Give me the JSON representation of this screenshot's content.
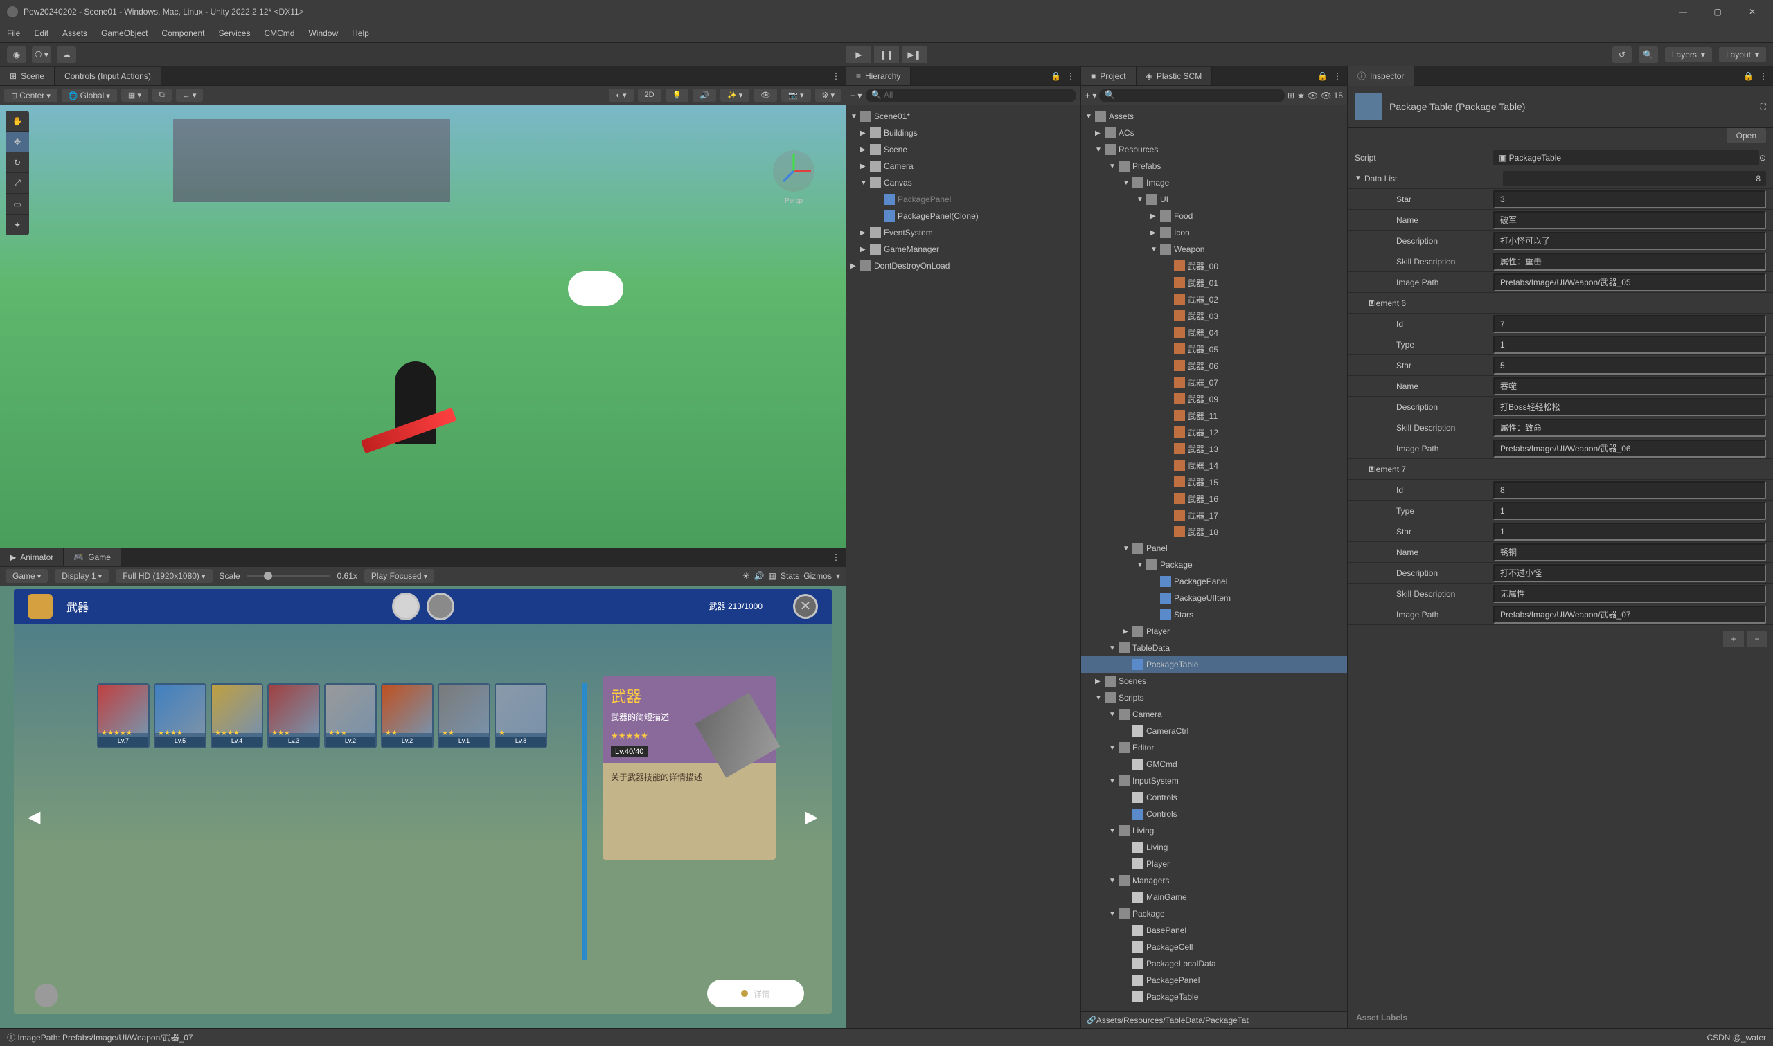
{
  "window": {
    "title": "Pow20240202 - Scene01 - Windows, Mac, Linux - Unity 2022.2.12* <DX11>",
    "min": "—",
    "max": "▢",
    "close": "✕"
  },
  "menu": [
    "File",
    "Edit",
    "Assets",
    "GameObject",
    "Component",
    "Services",
    "CMCmd",
    "Window",
    "Help"
  ],
  "toolbar": {
    "layers": "Layers",
    "layout": "Layout"
  },
  "scene": {
    "tab": "Scene",
    "controls_tab": "Controls (Input Actions)",
    "pivot": "Center",
    "space": "Global",
    "two_d": "2D",
    "persp": "Persp"
  },
  "animator_tab": "Animator",
  "game": {
    "tab": "Game",
    "target": "Game",
    "display": "Display 1",
    "res": "Full HD (1920x1080)",
    "scale_label": "Scale",
    "scale_val": "0.61x",
    "play_focused": "Play Focused",
    "stats": "Stats",
    "gizmos": "Gizmos",
    "bag_label": "武器",
    "count": "武器 213/1000",
    "weapons": [
      {
        "lv": "Lv.7",
        "stars": "★★★★★",
        "tint": "#c04040"
      },
      {
        "lv": "Lv.5",
        "stars": "★★★★",
        "tint": "#4080c0"
      },
      {
        "lv": "Lv.4",
        "stars": "★★★★",
        "tint": "#c0a040"
      },
      {
        "lv": "Lv.3",
        "stars": "★★★",
        "tint": "#a04040"
      },
      {
        "lv": "Lv.2",
        "stars": "★★★",
        "tint": "#9a9a9a"
      },
      {
        "lv": "Lv.2",
        "stars": "★★",
        "tint": "#c05020"
      },
      {
        "lv": "Lv.1",
        "stars": "★★",
        "tint": "#7a7a7a"
      },
      {
        "lv": "Lv.8",
        "stars": "★",
        "tint": "#8a9aaa"
      }
    ],
    "detail": {
      "title": "武器",
      "sub": "武器的简短描述",
      "stars": "★★★★★",
      "level": "Lv.40/40",
      "desc": "关于武器技能的详情描述",
      "btn": "详情"
    }
  },
  "hierarchy": {
    "tab": "Hierarchy",
    "search_placeholder": "All",
    "items": [
      {
        "label": "Scene01*",
        "depth": 0,
        "icon": "scene",
        "open": true
      },
      {
        "label": "Buildings",
        "depth": 1,
        "icon": "go"
      },
      {
        "label": "Scene",
        "depth": 1,
        "icon": "go"
      },
      {
        "label": "Camera",
        "depth": 1,
        "icon": "go"
      },
      {
        "label": "Canvas",
        "depth": 1,
        "icon": "go",
        "open": true
      },
      {
        "label": "PackagePanel",
        "depth": 2,
        "icon": "prefab",
        "dim": true
      },
      {
        "label": "PackagePanel(Clone)",
        "depth": 2,
        "icon": "prefab"
      },
      {
        "label": "EventSystem",
        "depth": 1,
        "icon": "go"
      },
      {
        "label": "GameManager",
        "depth": 1,
        "icon": "go"
      },
      {
        "label": "DontDestroyOnLoad",
        "depth": 0,
        "icon": "scene"
      }
    ]
  },
  "project": {
    "tab": "Project",
    "scm_tab": "Plastic SCM",
    "fav_count": "15",
    "tree": [
      {
        "label": "Assets",
        "depth": 0,
        "icon": "folder",
        "open": true
      },
      {
        "label": "ACs",
        "depth": 1,
        "icon": "folder"
      },
      {
        "label": "Resources",
        "depth": 1,
        "icon": "folder",
        "open": true
      },
      {
        "label": "Prefabs",
        "depth": 2,
        "icon": "folder",
        "open": true
      },
      {
        "label": "Image",
        "depth": 3,
        "icon": "folder",
        "open": true
      },
      {
        "label": "UI",
        "depth": 4,
        "icon": "folder",
        "open": true
      },
      {
        "label": "Food",
        "depth": 5,
        "icon": "folder"
      },
      {
        "label": "Icon",
        "depth": 5,
        "icon": "folder"
      },
      {
        "label": "Weapon",
        "depth": 5,
        "icon": "folder",
        "open": true
      },
      {
        "label": "武器_00",
        "depth": 6,
        "icon": "wp"
      },
      {
        "label": "武器_01",
        "depth": 6,
        "icon": "wp"
      },
      {
        "label": "武器_02",
        "depth": 6,
        "icon": "wp"
      },
      {
        "label": "武器_03",
        "depth": 6,
        "icon": "wp"
      },
      {
        "label": "武器_04",
        "depth": 6,
        "icon": "wp"
      },
      {
        "label": "武器_05",
        "depth": 6,
        "icon": "wp"
      },
      {
        "label": "武器_06",
        "depth": 6,
        "icon": "wp"
      },
      {
        "label": "武器_07",
        "depth": 6,
        "icon": "wp"
      },
      {
        "label": "武器_09",
        "depth": 6,
        "icon": "wp"
      },
      {
        "label": "武器_11",
        "depth": 6,
        "icon": "wp"
      },
      {
        "label": "武器_12",
        "depth": 6,
        "icon": "wp"
      },
      {
        "label": "武器_13",
        "depth": 6,
        "icon": "wp"
      },
      {
        "label": "武器_14",
        "depth": 6,
        "icon": "wp"
      },
      {
        "label": "武器_15",
        "depth": 6,
        "icon": "wp"
      },
      {
        "label": "武器_16",
        "depth": 6,
        "icon": "wp"
      },
      {
        "label": "武器_17",
        "depth": 6,
        "icon": "wp"
      },
      {
        "label": "武器_18",
        "depth": 6,
        "icon": "wp"
      },
      {
        "label": "Panel",
        "depth": 3,
        "icon": "folder",
        "open": true
      },
      {
        "label": "Package",
        "depth": 4,
        "icon": "folder",
        "open": true
      },
      {
        "label": "PackagePanel",
        "depth": 5,
        "icon": "prefab"
      },
      {
        "label": "PackageUIItem",
        "depth": 5,
        "icon": "prefab"
      },
      {
        "label": "Stars",
        "depth": 5,
        "icon": "prefab"
      },
      {
        "label": "Player",
        "depth": 3,
        "icon": "folder"
      },
      {
        "label": "TableData",
        "depth": 2,
        "icon": "folder",
        "open": true
      },
      {
        "label": "PackageTable",
        "depth": 3,
        "icon": "asset",
        "selected": true
      },
      {
        "label": "Scenes",
        "depth": 1,
        "icon": "folder"
      },
      {
        "label": "Scripts",
        "depth": 1,
        "icon": "folder",
        "open": true
      },
      {
        "label": "Camera",
        "depth": 2,
        "icon": "folder",
        "open": true
      },
      {
        "label": "CameraCtrl",
        "depth": 3,
        "icon": "cs"
      },
      {
        "label": "Editor",
        "depth": 2,
        "icon": "folder",
        "open": true
      },
      {
        "label": "GMCmd",
        "depth": 3,
        "icon": "cs"
      },
      {
        "label": "InputSystem",
        "depth": 2,
        "icon": "folder",
        "open": true
      },
      {
        "label": "Controls",
        "depth": 3,
        "icon": "cs"
      },
      {
        "label": "Controls",
        "depth": 3,
        "icon": "asset"
      },
      {
        "label": "Living",
        "depth": 2,
        "icon": "folder",
        "open": true
      },
      {
        "label": "Living",
        "depth": 3,
        "icon": "cs"
      },
      {
        "label": "Player",
        "depth": 3,
        "icon": "cs"
      },
      {
        "label": "Managers",
        "depth": 2,
        "icon": "folder",
        "open": true
      },
      {
        "label": "MainGame",
        "depth": 3,
        "icon": "cs"
      },
      {
        "label": "Package",
        "depth": 2,
        "icon": "folder",
        "open": true
      },
      {
        "label": "BasePanel",
        "depth": 3,
        "icon": "cs"
      },
      {
        "label": "PackageCell",
        "depth": 3,
        "icon": "cs"
      },
      {
        "label": "PackageLocalData",
        "depth": 3,
        "icon": "cs"
      },
      {
        "label": "PackagePanel",
        "depth": 3,
        "icon": "cs"
      },
      {
        "label": "PackageTable",
        "depth": 3,
        "icon": "cs"
      }
    ],
    "path": "Assets/Resources/TableData/PackageTat"
  },
  "inspector": {
    "tab": "Inspector",
    "title": "Package Table (Package Table)",
    "open": "Open",
    "rows": [
      {
        "type": "script",
        "label": "Script",
        "value": "PackageTable"
      },
      {
        "type": "header",
        "label": "Data List",
        "value": "8"
      },
      {
        "type": "field",
        "indent": 2,
        "label": "Star",
        "value": "3"
      },
      {
        "type": "field",
        "indent": 2,
        "label": "Name",
        "value": "破军"
      },
      {
        "type": "field",
        "indent": 2,
        "label": "Description",
        "value": "打小怪可以了"
      },
      {
        "type": "field",
        "indent": 2,
        "label": "Skill Description",
        "value": "属性：重击"
      },
      {
        "type": "field",
        "indent": 2,
        "label": "Image Path",
        "value": "Prefabs/Image/UI/Weapon/武器_05"
      },
      {
        "type": "element",
        "indent": 1,
        "label": "Element 6"
      },
      {
        "type": "field",
        "indent": 2,
        "label": "Id",
        "value": "7"
      },
      {
        "type": "field",
        "indent": 2,
        "label": "Type",
        "value": "1"
      },
      {
        "type": "field",
        "indent": 2,
        "label": "Star",
        "value": "5"
      },
      {
        "type": "field",
        "indent": 2,
        "label": "Name",
        "value": "吞噬"
      },
      {
        "type": "field",
        "indent": 2,
        "label": "Description",
        "value": "打Boss轻轻松松"
      },
      {
        "type": "field",
        "indent": 2,
        "label": "Skill Description",
        "value": "属性：致命"
      },
      {
        "type": "field",
        "indent": 2,
        "label": "Image Path",
        "value": "Prefabs/Image/UI/Weapon/武器_06"
      },
      {
        "type": "element",
        "indent": 1,
        "label": "Element 7"
      },
      {
        "type": "field",
        "indent": 2,
        "label": "Id",
        "value": "8"
      },
      {
        "type": "field",
        "indent": 2,
        "label": "Type",
        "value": "1"
      },
      {
        "type": "field",
        "indent": 2,
        "label": "Star",
        "value": "1"
      },
      {
        "type": "field",
        "indent": 2,
        "label": "Name",
        "value": "锈铜"
      },
      {
        "type": "field",
        "indent": 2,
        "label": "Description",
        "value": "打不过小怪"
      },
      {
        "type": "field",
        "indent": 2,
        "label": "Skill Description",
        "value": "无属性"
      },
      {
        "type": "field",
        "indent": 2,
        "label": "Image Path",
        "value": "Prefabs/Image/UI/Weapon/武器_07"
      }
    ],
    "asset_labels": "Asset Labels"
  },
  "statusbar": {
    "left": "ImagePath: Prefabs/Image/UI/Weapon/武器_07",
    "right": "CSDN @_water"
  }
}
